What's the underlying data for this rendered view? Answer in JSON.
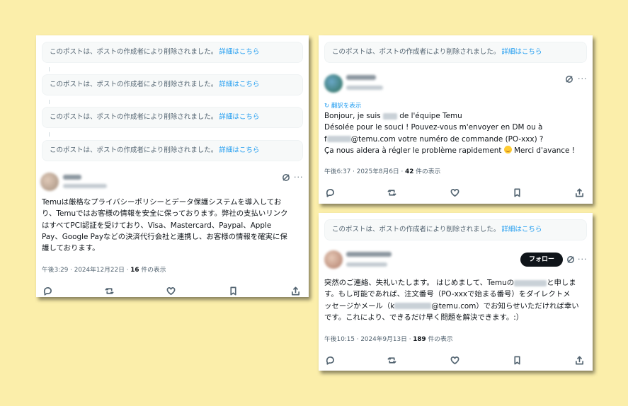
{
  "deleted_notice": {
    "text": "このポストは、ポストの作成者により削除されました。",
    "link": "詳細はこちら"
  },
  "left_post": {
    "text": "Temuは厳格なプライバシーポリシーとデータ保護システムを導入しており、Temuではお客様の情報を安全に保っております。弊社の支払いリンクはすべてPCI認証を受けており、Visa、Mastercard、Paypal、Apple Pay、Google Payなどの決済代行会社と連携し、お客様の情報を確実に保護しております。",
    "timestamp": "午後3:29 · 2024年12月22日 · ",
    "views_count": "16",
    "views_label": " 件の表示"
  },
  "top_right_post": {
    "translate_label": "翻訳を表示",
    "line1_a": "Bonjour, je suis ",
    "line1_b": " de l'équipe Temu",
    "line2": "Désolée pour le souci ! Pouvez-vous m'envoyer en DM ou à",
    "line3_a": "f",
    "line3_b": "@temu.com votre numéro de commande (PO-xxx) ?",
    "line4": "Ça nous aidera à régler le problème rapidement ",
    "line4_b": " Merci d'avance !",
    "timestamp": "午後6:37 · 2025年8月6日 · ",
    "views_count": "42",
    "views_label": " 件の表示"
  },
  "bottom_right_post": {
    "follow_label": "フォロー",
    "line1_a": "突然のご連絡、失礼いたします。 はじめまして、Temuの",
    "line1_b": "と申しま",
    "line2": "す。もし可能であれば、注文番号（PO-xxxで始まる番号）をダイレクトメ",
    "line3_a": "ッセージかメール（k",
    "line3_b": "@temu.com）でお知らせいただければ幸い",
    "line4": "です。これにより、できるだけ早く問題を解決できます。:）",
    "timestamp": "午後10:15 · 2024年9月13日 · ",
    "views_count": "189",
    "views_label": " 件の表示"
  },
  "icons": [
    "reply-icon",
    "repost-icon",
    "like-icon",
    "bookmark-icon",
    "share-icon",
    "grok-icon",
    "more-icon",
    "translate-icon"
  ],
  "colors": {
    "background": "#fbeeaa",
    "link": "#1d9bf0",
    "secondary_text": "#536471",
    "follow_button": "#0f1419"
  }
}
